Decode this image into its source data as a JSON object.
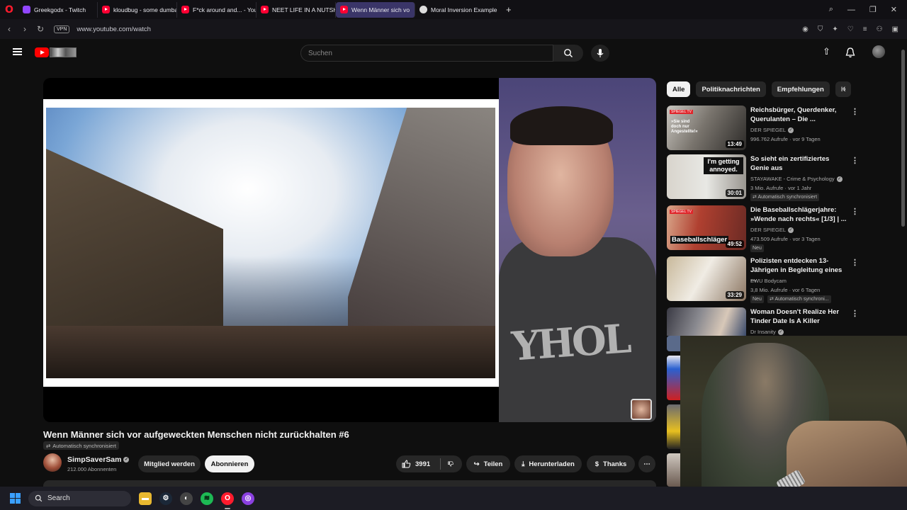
{
  "browser": {
    "tabs": [
      {
        "label": "Greekgodx - Twitch",
        "favicon": "twitch-icon"
      },
      {
        "label": "kloudbug - some dumbas",
        "favicon": "youtube-icon"
      },
      {
        "label": "F*ck around and... - YouTu",
        "favicon": "youtube-icon"
      },
      {
        "label": "NEET LIFE IN A NUTSHELL",
        "favicon": "youtube-icon"
      },
      {
        "label": "Wenn Männer sich vo",
        "favicon": "youtube-icon",
        "active": true
      },
      {
        "label": "Moral Inversion Example",
        "favicon": "globe-icon"
      }
    ],
    "vpn_label": "VPN",
    "url": "www.youtube.com/watch"
  },
  "youtube": {
    "search_placeholder": "Suchen"
  },
  "video": {
    "title": "Wenn Männer sich vor aufgeweckten Menschen nicht zurückhalten #6",
    "sync_badge": "Automatisch synchronisiert",
    "shirt_text": "YHOL",
    "channel": {
      "name": "SimpSaverSam",
      "subscribers": "212.000 Abonnenten"
    },
    "actions": {
      "join": "Mitglied werden",
      "subscribe": "Abonnieren",
      "likes": "3991",
      "share": "Teilen",
      "download": "Herunterladen",
      "thanks": "Thanks"
    }
  },
  "chips": [
    "Alle",
    "Politiknachrichten",
    "Empfehlungen",
    "K"
  ],
  "recommendations": [
    {
      "title": "Reichsbürger, Querdenker, Querulanten – Die ...",
      "channel": "DER SPIEGEL",
      "meta": "996.762 Aufrufe · vor 9 Tagen",
      "duration": "13:49",
      "thumb_text": "»Sie sind doch nur Angestellte!«"
    },
    {
      "title": "So sieht ein zertifiziertes Genie aus",
      "channel": "STAYAWAKE - Crime & Psychology",
      "meta": "3 Mio. Aufrufe · vor 1 Jahr",
      "duration": "30:01",
      "badge": "Automatisch synchronisiert",
      "thumb_text": "I'm getting annoyed."
    },
    {
      "title": "Die Baseballschlägerjahre: »Wende nach rechts« [1/3] | ...",
      "channel": "DER SPIEGEL",
      "meta": "473.509 Aufrufe · vor 3 Tagen",
      "duration": "49:52",
      "badge": "Neu",
      "thumb_text": "Baseballschläger"
    },
    {
      "title": "Polizisten entdecken 13-Jährigen in Begleitung eines ...",
      "channel": "EWU Bodycam",
      "meta": "3,8 Mio. Aufrufe · vor 6 Tagen",
      "duration": "33:29",
      "badge": "Neu",
      "badge2": "Automatisch synchroni..."
    },
    {
      "title": "Woman Doesn't Realize Her Tinder Date Is A Killer",
      "channel": "Dr Insanity"
    }
  ],
  "taskbar": {
    "search_label": "Search"
  },
  "colors": {
    "youtube_red": "#ff0000",
    "background": "#0f0f0f",
    "chip_bg": "#272727",
    "active_tab": "#3a3568"
  }
}
